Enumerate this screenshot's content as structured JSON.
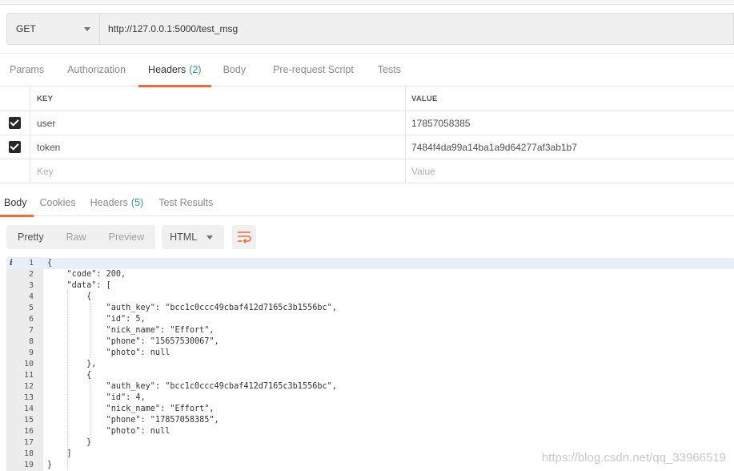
{
  "request": {
    "method": "GET",
    "url": "http://127.0.0.1:5000/test_msg"
  },
  "request_tabs": [
    {
      "label": "Params",
      "count": ""
    },
    {
      "label": "Authorization",
      "count": ""
    },
    {
      "label": "Headers",
      "count": "(2)"
    },
    {
      "label": "Body",
      "count": ""
    },
    {
      "label": "Pre-request Script",
      "count": ""
    },
    {
      "label": "Tests",
      "count": ""
    }
  ],
  "headers_table": {
    "key_header": "KEY",
    "value_header": "VALUE",
    "rows": [
      {
        "key": "user",
        "value": "17857058385",
        "checked": true
      },
      {
        "key": "token",
        "value": "7484f4da99a14ba1a9d64277af3ab1b7",
        "checked": true
      }
    ],
    "key_placeholder": "Key",
    "value_placeholder": "Value"
  },
  "response_tabs": [
    {
      "label": "Body",
      "count": ""
    },
    {
      "label": "Cookies",
      "count": ""
    },
    {
      "label": "Headers",
      "count": "(5)"
    },
    {
      "label": "Test Results",
      "count": ""
    }
  ],
  "view_modes": [
    "Pretty",
    "Raw",
    "Preview"
  ],
  "format": "HTML",
  "code_lines": [
    {
      "n": "1",
      "text": "{"
    },
    {
      "n": "2",
      "text": "    \"code\": 200,"
    },
    {
      "n": "3",
      "text": "    \"data\": ["
    },
    {
      "n": "4",
      "text": "        {"
    },
    {
      "n": "5",
      "text": "            \"auth_key\": \"bcc1c0ccc49cbaf412d7165c3b1556bc\","
    },
    {
      "n": "6",
      "text": "            \"id\": 5,"
    },
    {
      "n": "7",
      "text": "            \"nick_name\": \"Effort\","
    },
    {
      "n": "8",
      "text": "            \"phone\": \"15657530067\","
    },
    {
      "n": "9",
      "text": "            \"photo\": null"
    },
    {
      "n": "10",
      "text": "        },"
    },
    {
      "n": "11",
      "text": "        {"
    },
    {
      "n": "12",
      "text": "            \"auth_key\": \"bcc1c0ccc49cbaf412d7165c3b1556bc\","
    },
    {
      "n": "13",
      "text": "            \"id\": 4,"
    },
    {
      "n": "14",
      "text": "            \"nick_name\": \"Effort\","
    },
    {
      "n": "15",
      "text": "            \"phone\": \"17857058385\","
    },
    {
      "n": "16",
      "text": "            \"photo\": null"
    },
    {
      "n": "17",
      "text": "        }"
    },
    {
      "n": "18",
      "text": "    ]"
    },
    {
      "n": "19",
      "text": "}"
    }
  ],
  "info_marker": "i",
  "watermark": "https://blog.csdn.net/qq_33966519",
  "colors": {
    "accent": "#f26b3a",
    "count": "#2b9e8e"
  }
}
